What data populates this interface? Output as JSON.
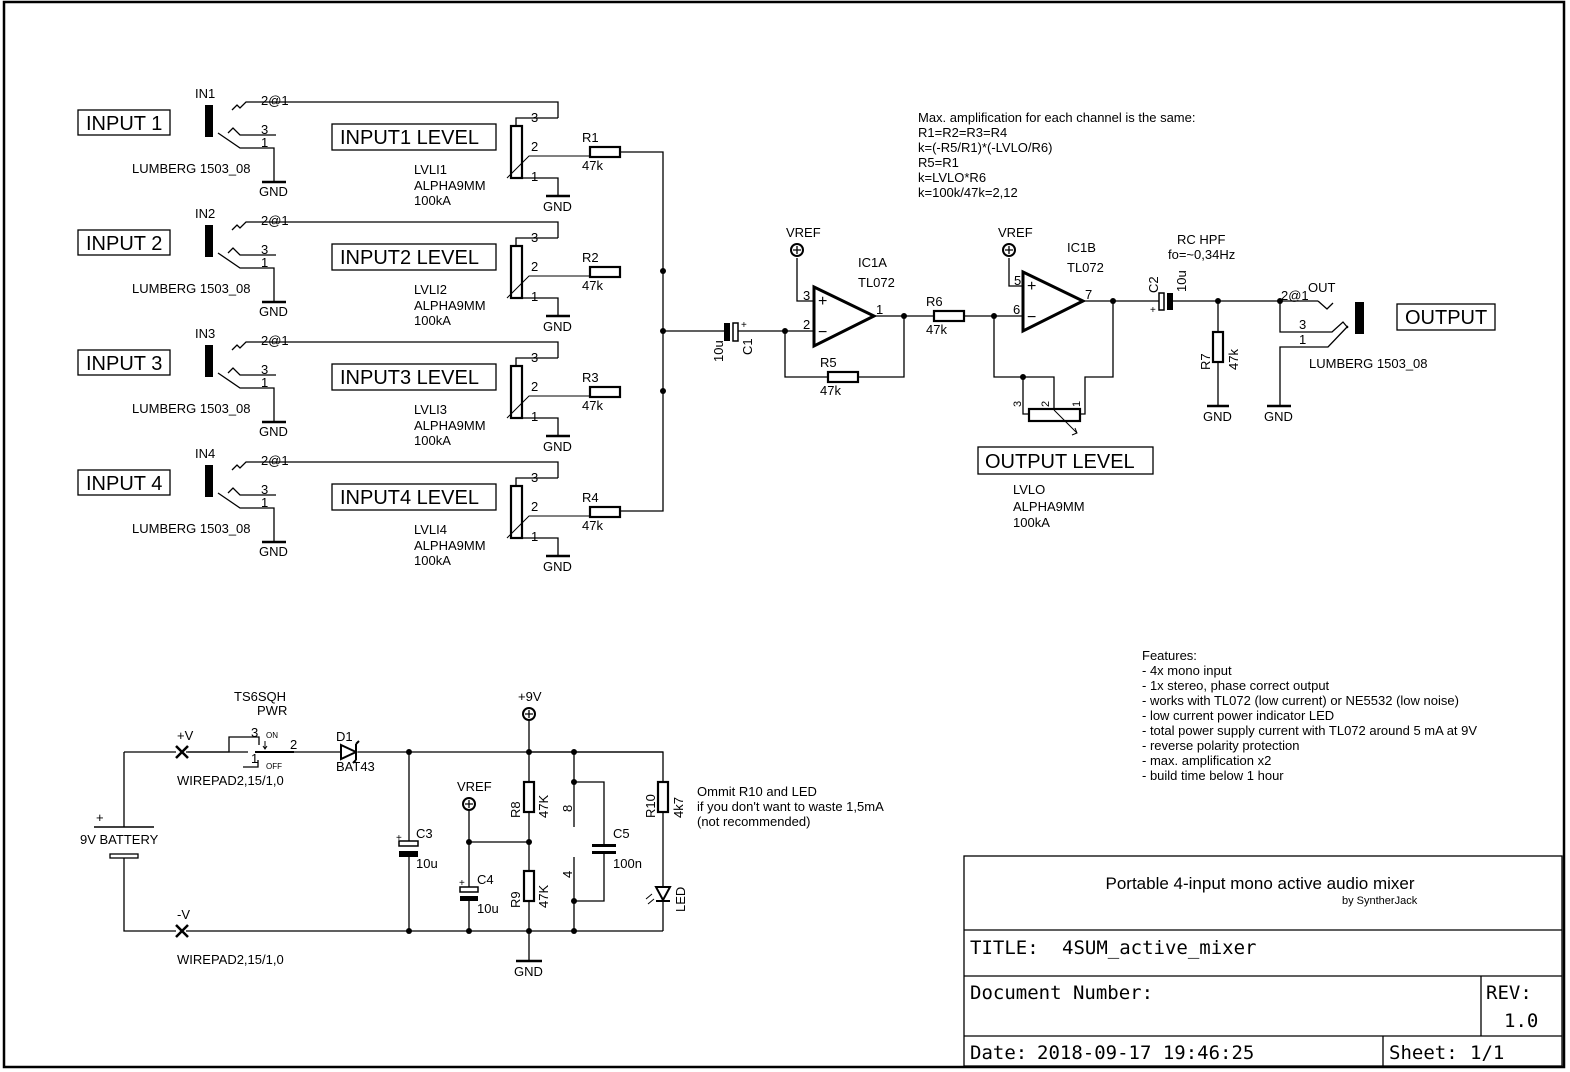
{
  "sheet": {
    "colors": {
      "ink": "#000000",
      "paper": "#ffffff"
    }
  },
  "inputs": [
    {
      "label": "INPUT 1",
      "jack_ref": "IN1",
      "jack_part": "LUMBERG 1503_08",
      "pin_tip": "2@1",
      "pin_3": "3",
      "pin_1": "1",
      "gnd": "GND",
      "level_label": "INPUT1  LEVEL",
      "pot_ref": "LVLI1",
      "pot_part": "ALPHA9MM",
      "pot_value": "100kA",
      "pot_pin3": "3",
      "pot_pin2": "2",
      "pot_pin1": "1",
      "pot_gnd": "GND",
      "res_ref": "R1",
      "res_value": "47k"
    },
    {
      "label": "INPUT 2",
      "jack_ref": "IN2",
      "jack_part": "LUMBERG 1503_08",
      "pin_tip": "2@1",
      "pin_3": "3",
      "pin_1": "1",
      "gnd": "GND",
      "level_label": "INPUT2  LEVEL",
      "pot_ref": "LVLI2",
      "pot_part": "ALPHA9MM",
      "pot_value": "100kA",
      "pot_pin3": "3",
      "pot_pin2": "2",
      "pot_pin1": "1",
      "pot_gnd": "GND",
      "res_ref": "R2",
      "res_value": "47k"
    },
    {
      "label": "INPUT 3",
      "jack_ref": "IN3",
      "jack_part": "LUMBERG 1503_08",
      "pin_tip": "2@1",
      "pin_3": "3",
      "pin_1": "1",
      "gnd": "GND",
      "level_label": "INPUT3  LEVEL",
      "pot_ref": "LVLI3",
      "pot_part": "ALPHA9MM",
      "pot_value": "100kA",
      "pot_pin3": "3",
      "pot_pin2": "2",
      "pot_pin1": "1",
      "pot_gnd": "GND",
      "res_ref": "R3",
      "res_value": "47k"
    },
    {
      "label": "INPUT 4",
      "jack_ref": "IN4",
      "jack_part": "LUMBERG 1503_08",
      "pin_tip": "2@1",
      "pin_3": "3",
      "pin_1": "1",
      "gnd": "GND",
      "level_label": "INPUT4  LEVEL",
      "pot_ref": "LVLI4",
      "pot_part": "ALPHA9MM",
      "pot_value": "100kA",
      "pot_pin3": "3",
      "pot_pin2": "2",
      "pot_pin1": "1",
      "pot_gnd": "GND",
      "res_ref": "R4",
      "res_value": "47k"
    }
  ],
  "c1": {
    "ref": "C1",
    "value": "10u",
    "plus": "+"
  },
  "ic1a": {
    "ref": "IC1A",
    "part": "TL072",
    "vref": "VREF",
    "pin_plus": "3",
    "pin_minus": "2",
    "pin_out": "1",
    "plus_sign": "+",
    "minus_sign": "−"
  },
  "r5": {
    "ref": "R5",
    "value": "47k"
  },
  "r6": {
    "ref": "R6",
    "value": "47k"
  },
  "ic1b": {
    "ref": "IC1B",
    "part": "TL072",
    "vref": "VREF",
    "pin_plus": "5",
    "pin_minus": "6",
    "pin_out": "7",
    "plus_sign": "+",
    "minus_sign": "−"
  },
  "output_level": {
    "label": "OUTPUT  LEVEL",
    "ref": "LVLO",
    "part": "ALPHA9MM",
    "value": "100kA",
    "pin3": "3",
    "pin2": "2",
    "pin1": "1"
  },
  "hpf": {
    "title": "RC HPF",
    "fo": "fo=~0,34Hz",
    "c2_ref": "C2",
    "c2_value": "10u",
    "plus": "+",
    "r7_ref": "R7",
    "r7_value": "47k",
    "gnd": "GND"
  },
  "output": {
    "label": "OUTPUT",
    "jack_ref": "OUT",
    "jack_part": "LUMBERG 1503_08",
    "pin_tip": "2@1",
    "pin_3": "3",
    "pin_1": "1",
    "gnd": "GND"
  },
  "note_amp": [
    "Max. amplification for each channel is the same:",
    "R1=R2=R3=R4",
    "k=(-R5/R1)*(-LVLO/R6)",
    "R5=R1",
    "k=LVLO*R6",
    "k=100k/47k=2,12"
  ],
  "features": [
    "Features:",
    "- 4x mono input",
    "- 1x stereo, phase correct output",
    "- works with TL072 (low current) or NE5532 (low noise)",
    "- low current power indicator LED",
    "- total power supply current with TL072 around 5 mA at 9V",
    "- reverse polarity protection",
    "- max. amplification x2",
    "- build time below 1 hour"
  ],
  "power": {
    "battery": "9V BATTERY",
    "battery_plus": "+",
    "pad_pos": "+V",
    "pad_neg": "-V",
    "pad_part": "WIREPAD2,15/1,0",
    "switch_part": "TS6SQH",
    "switch_ref": "PWR",
    "sw_pin3": "3",
    "sw_pin1": "1",
    "sw_pin2": "2",
    "sw_on": "ON",
    "sw_off": "OFF",
    "diode_ref": "D1",
    "diode_part": "BAT43",
    "c3_ref": "C3",
    "c3_value": "10u",
    "rail": "+9V",
    "vref": "VREF",
    "c4_ref": "C4",
    "c4_value": "10u",
    "r8_ref": "R8",
    "r8_value": "47K",
    "r9_ref": "R9",
    "r9_value": "47K",
    "ic_pin8": "8",
    "ic_pin4": "4",
    "c5_ref": "C5",
    "c5_value": "100n",
    "r10_ref": "R10",
    "r10_value": "4k7",
    "led_ref": "LED",
    "gnd": "GND",
    "plus": "+"
  },
  "note_led": [
    "Ommit R10 and LED",
    "if you don't want to waste 1,5mA",
    "(not recommended)"
  ],
  "title_block": {
    "project": "Portable 4-input mono active audio mixer",
    "author": "by SyntherJack",
    "title_label": "TITLE:",
    "title_value": "4SUM_active_mixer",
    "docnum_label": "Document Number:",
    "rev_label": "REV:",
    "rev_value": "1.0",
    "date_label": "Date:",
    "date_value": "2018-09-17 19:46:25",
    "sheet_label": "Sheet:",
    "sheet_value": "1/1"
  }
}
